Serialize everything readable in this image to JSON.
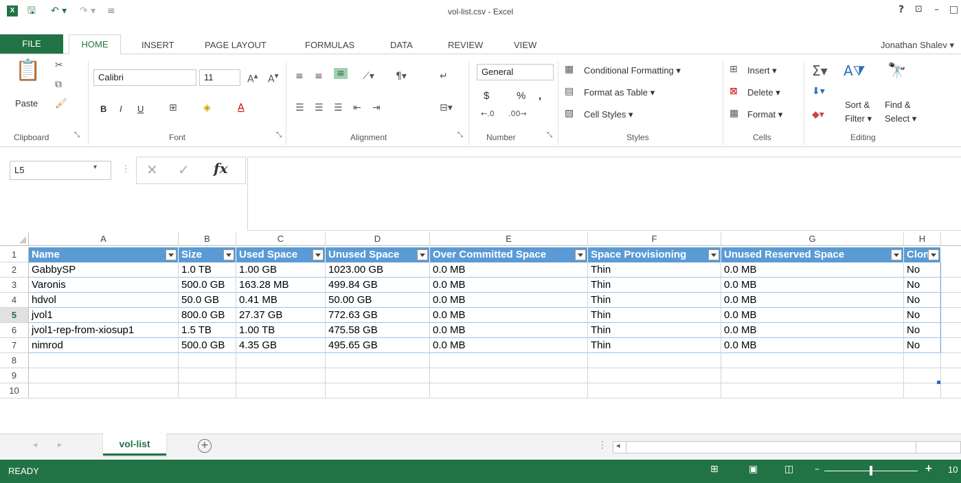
{
  "window": {
    "title": "vol-list.csv - Excel",
    "app_icon": "excel-icon",
    "help": "?",
    "restore_icon": "ribbon-display-icon",
    "minimize": "–",
    "maximize": "□"
  },
  "tabs": {
    "file": "FILE",
    "home": "HOME",
    "insert": "INSERT",
    "page_layout": "PAGE LAYOUT",
    "formulas": "FORMULAS",
    "data": "DATA",
    "review": "REVIEW",
    "view": "VIEW",
    "user": "Jonathan Shalev ▾"
  },
  "ribbon": {
    "clipboard": {
      "label": "Clipboard",
      "paste": "Paste"
    },
    "font": {
      "label": "Font",
      "name": "Calibri",
      "size": "11",
      "bold": "B",
      "italic": "I",
      "underline": "U"
    },
    "alignment": {
      "label": "Alignment"
    },
    "number": {
      "label": "Number",
      "format": "General",
      "currency": "$",
      "percent": "%",
      "comma": ","
    },
    "styles": {
      "label": "Styles",
      "conditional": "Conditional Formatting ▾",
      "format_table": "Format as Table ▾",
      "cell_styles": "Cell Styles ▾"
    },
    "cells": {
      "label": "Cells",
      "insert": "Insert ▾",
      "delete": "Delete ▾",
      "format": "Format ▾"
    },
    "editing": {
      "label": "Editing",
      "sort1": "Sort &",
      "sort2": "Filter ▾",
      "find1": "Find &",
      "find2": "Select ▾"
    }
  },
  "formula_bar": {
    "name_box": "L5",
    "fx": "fx",
    "cancel": "✕",
    "enter": "✓",
    "formula": ""
  },
  "grid": {
    "columns": [
      "A",
      "B",
      "C",
      "D",
      "E",
      "F",
      "G",
      "H"
    ],
    "rows": [
      "1",
      "2",
      "3",
      "4",
      "5",
      "6",
      "7",
      "8",
      "9",
      "10"
    ],
    "active_row": "5",
    "headers": [
      "Name",
      "Size",
      "Used Space",
      "Unused Space",
      "Over Committed Space",
      "Space Provisioning",
      "Unused Reserved Space",
      "Clone"
    ],
    "data": [
      [
        "GabbySP",
        "1.0 TB",
        "1.00 GB",
        "1023.00 GB",
        "0.0 MB",
        "Thin",
        "0.0 MB",
        "No"
      ],
      [
        "Varonis",
        "500.0 GB",
        "163.28 MB",
        "499.84 GB",
        "0.0 MB",
        "Thin",
        "0.0 MB",
        "No"
      ],
      [
        "hdvol",
        "50.0 GB",
        "0.41 MB",
        "50.00 GB",
        "0.0 MB",
        "Thin",
        "0.0 MB",
        "No"
      ],
      [
        "jvol1",
        "800.0 GB",
        "27.37 GB",
        "772.63 GB",
        "0.0 MB",
        "Thin",
        "0.0 MB",
        "No"
      ],
      [
        "jvol1-rep-from-xiosup1",
        "1.5 TB",
        "1.00 TB",
        "475.58 GB",
        "0.0 MB",
        "Thin",
        "0.0 MB",
        "No"
      ],
      [
        "nimrod",
        "500.0 GB",
        "4.35 GB",
        "495.65 GB",
        "0.0 MB",
        "Thin",
        "0.0 MB",
        "No"
      ]
    ]
  },
  "sheets": {
    "active": "vol-list",
    "add": "+"
  },
  "status": {
    "ready": "READY",
    "zoom": "10"
  },
  "colors": {
    "excel_green": "#217346",
    "table_header": "#5b9bd5"
  }
}
